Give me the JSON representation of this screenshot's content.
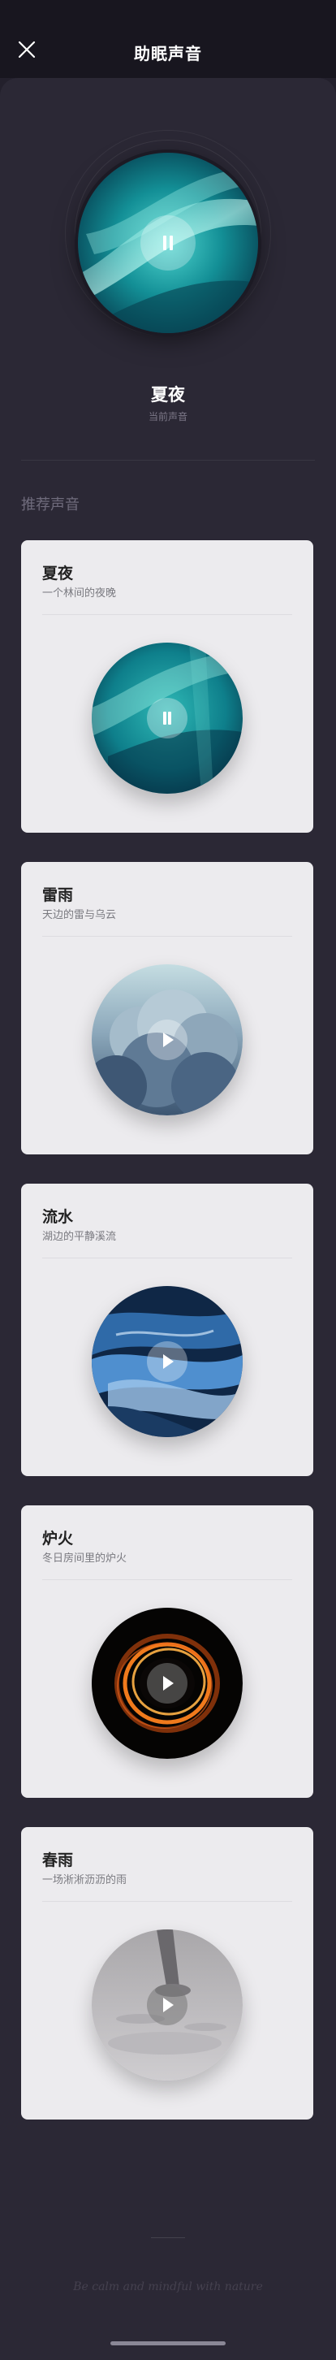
{
  "header": {
    "title": "助眠声音",
    "close_icon": "close-icon"
  },
  "now_playing": {
    "name": "夏夜",
    "subtitle": "当前声音",
    "state": "playing"
  },
  "section": {
    "title": "推荐声音"
  },
  "cards": [
    {
      "name": "夏夜",
      "desc": "一个林间的夜晚",
      "state": "playing",
      "icon": "pause-icon"
    },
    {
      "name": "雷雨",
      "desc": "天边的雷与乌云",
      "state": "paused",
      "icon": "play-icon"
    },
    {
      "name": "流水",
      "desc": "湖边的平静溪流",
      "state": "paused",
      "icon": "play-icon"
    },
    {
      "name": "炉火",
      "desc": "冬日房间里的炉火",
      "state": "paused",
      "icon": "play-icon"
    },
    {
      "name": "春雨",
      "desc": "一场淅淅沥沥的雨",
      "state": "paused",
      "icon": "play-icon"
    }
  ],
  "footer": {
    "tagline": "Be calm and mindful with nature"
  },
  "colors": {
    "background": "#23202c",
    "panel": "#2b2835",
    "card": "#ecebee",
    "accent_teal": "#1aa7a8"
  }
}
